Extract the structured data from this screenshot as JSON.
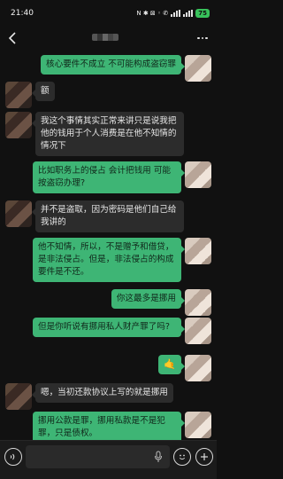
{
  "status_bar": {
    "time": "21:40",
    "indicators": "N ✱ ⊠ ◦ ✆",
    "battery": "75"
  },
  "header": {
    "contact_name": ""
  },
  "messages": [
    {
      "side": "right",
      "text": "核心要件不成立 不可能构成盗窃罪"
    },
    {
      "side": "left",
      "text": "额"
    },
    {
      "side": "left",
      "text": "我这个事情其实正常来讲只是说我把他的钱用于个人消费是在他不知情的情况下"
    },
    {
      "side": "right",
      "text": "比如职务上的侵占 会计把钱用 可能按盗窃办理?"
    },
    {
      "side": "left",
      "text": "并不是盗取，因为密码是他们自己给我讲的"
    },
    {
      "side": "right",
      "text": "他不知情，所以，不是赠予和借贷，是非法侵占。但是，非法侵占的构成要件是不还。"
    },
    {
      "side": "right",
      "text": "你这最多是挪用"
    },
    {
      "side": "right",
      "text": "但是你听说有挪用私人财产罪了吗?"
    },
    {
      "side": "right",
      "text": "🤙"
    },
    {
      "side": "left",
      "text": "嗯，当初还款协议上写的就是挪用"
    },
    {
      "side": "right",
      "text": "挪用公款是罪，挪用私款是不是犯罪，只是债权。"
    }
  ],
  "input_bar": {
    "placeholder": ""
  },
  "icons": {
    "back": "back-arrow-icon",
    "more": "more-dots-icon",
    "voice": "voice-icon",
    "mic": "mic-icon",
    "emoji": "emoji-icon",
    "plus": "plus-icon"
  },
  "colors": {
    "background": "#111111",
    "bubble_self": "#3eb575",
    "bubble_other": "#2c2c2c",
    "battery": "#38c25b"
  }
}
